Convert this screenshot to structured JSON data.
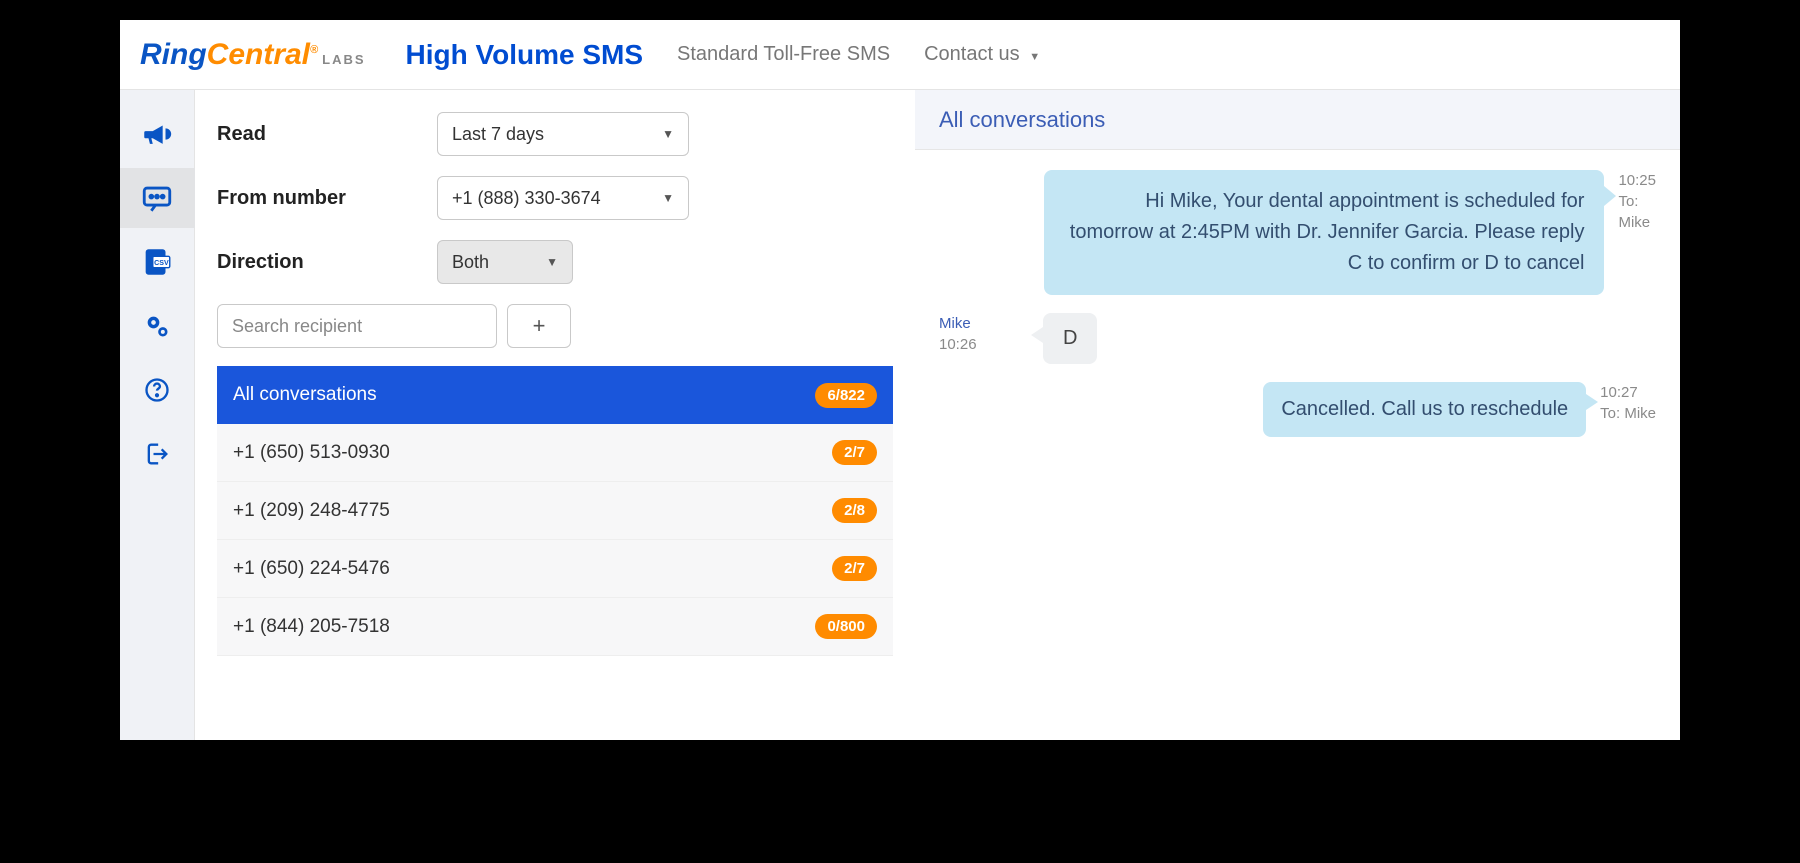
{
  "header": {
    "logo_ring": "Ring",
    "logo_central": "Central",
    "logo_reg": "®",
    "logo_labs": "LABS",
    "primary_link": "High Volume SMS",
    "link_standard": "Standard Toll-Free SMS",
    "link_contact": "Contact us"
  },
  "filters": {
    "read_label": "Read",
    "read_value": "Last 7 days",
    "from_label": "From number",
    "from_value": "+1 (888) 330-3674",
    "dir_label": "Direction",
    "dir_value": "Both",
    "search_placeholder": "Search recipient",
    "plus": "+"
  },
  "conversations": [
    {
      "label": "All conversations",
      "badge": "6/822",
      "selected": true
    },
    {
      "label": "+1 (650) 513-0930",
      "badge": "2/7",
      "selected": false
    },
    {
      "label": "+1 (209) 248-4775",
      "badge": "2/8",
      "selected": false
    },
    {
      "label": "+1 (650) 224-5476",
      "badge": "2/7",
      "selected": false
    },
    {
      "label": "+1 (844) 205-7518",
      "badge": "0/800",
      "selected": false
    }
  ],
  "chat": {
    "title": "All conversations",
    "msg0_text": "Hi Mike, Your dental appointment is scheduled for tomorrow at 2:45PM with Dr. Jennifer Garcia. Please reply C to confirm or D to cancel",
    "msg0_time": "10:25",
    "msg0_to_label": "To:",
    "msg0_to": "Mike",
    "msg1_name": "Mike",
    "msg1_time": "10:26",
    "msg1_text": "D",
    "msg2_text": "Cancelled. Call us to reschedule",
    "msg2_time": "10:27",
    "msg2_to": "To: Mike"
  }
}
